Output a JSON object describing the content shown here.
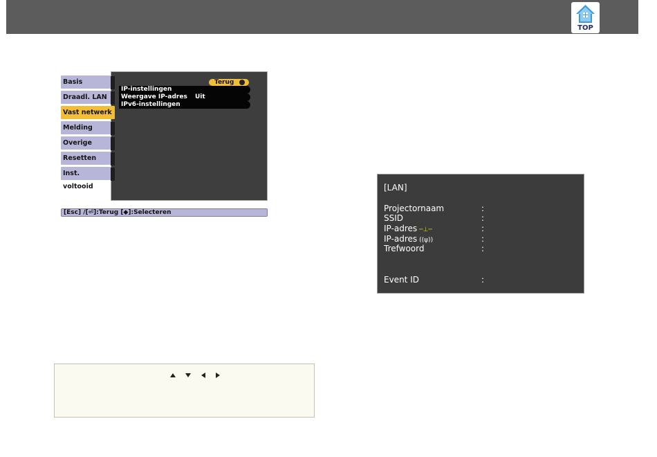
{
  "header": {
    "top_link_label": "TOP",
    "top_icon": "home-icon",
    "bar_color": "#5c5c5c"
  },
  "projector_menu": {
    "tabs": [
      {
        "label": "Basis",
        "active": false
      },
      {
        "label": "Draadl. LAN",
        "active": false
      },
      {
        "label": "Vast netwerk",
        "active": true
      },
      {
        "label": "Melding",
        "active": false
      },
      {
        "label": "Overige",
        "active": false
      },
      {
        "label": "Resetten",
        "active": false
      },
      {
        "label": "Inst. voltooid",
        "active": false
      }
    ],
    "back_label": "Terug",
    "items": [
      {
        "label": "IP-instellingen",
        "value": ""
      },
      {
        "label": "Weergave IP-adres",
        "value": "Uit"
      },
      {
        "label": "IPv6-instellingen",
        "value": ""
      }
    ],
    "help_text": "[Esc] /[⏎]:Terug  [◆]:Selecteren",
    "accent_color": "#f3be37",
    "tab_color": "#b8b6d8"
  },
  "lan_screen": {
    "title": "[LAN]",
    "rows": [
      {
        "label": "Projectornaam",
        "symbol": "",
        "separator": ":"
      },
      {
        "label": "SSID",
        "symbol": "",
        "separator": ":"
      },
      {
        "label": "IP-adres",
        "symbol": "wired",
        "separator": ":"
      },
      {
        "label": "IP-adres",
        "symbol": "wireless",
        "separator": ":"
      },
      {
        "label": "Trefwoord",
        "symbol": "",
        "separator": ":"
      },
      {
        "label": "Event ID",
        "symbol": "",
        "separator": ":"
      }
    ]
  },
  "note": {
    "arrow_icons": [
      "arrow-up-icon",
      "arrow-down-icon",
      "arrow-left-icon",
      "arrow-right-icon"
    ]
  }
}
